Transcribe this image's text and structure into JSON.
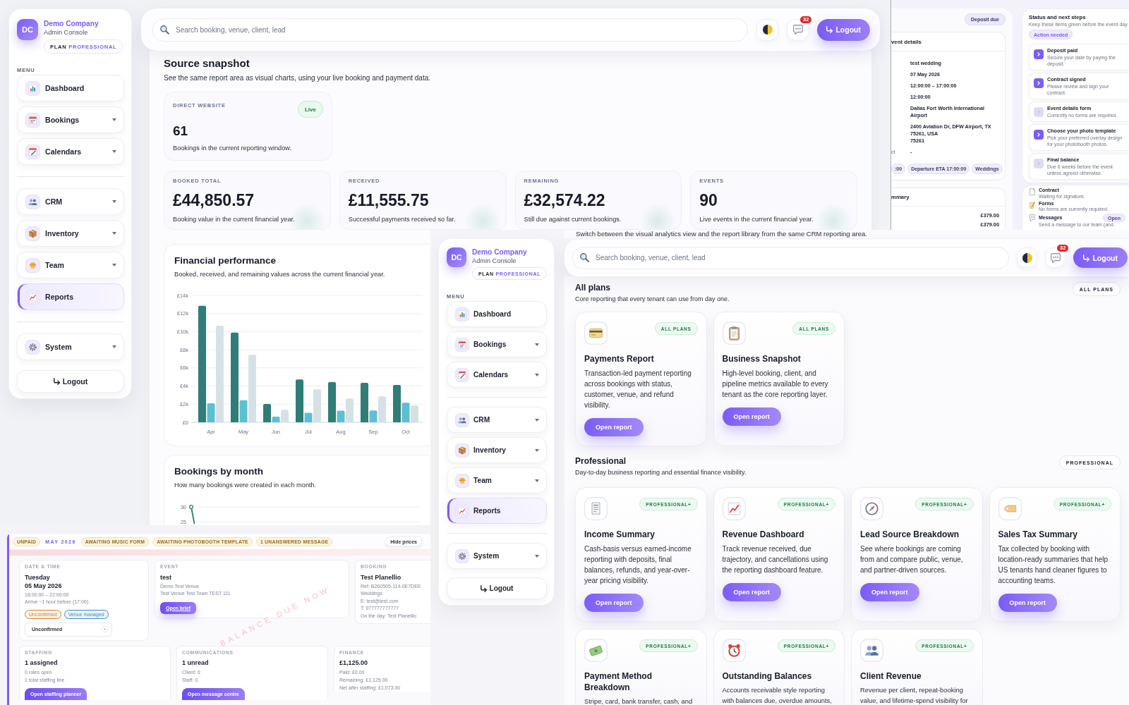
{
  "analytics_screen": {
    "sidebar": {
      "logo": "DC",
      "company": "Demo Company",
      "subtitle": "Admin Console",
      "plan_label": "PLAN",
      "plan_name": "PROFESSIONAL",
      "menu_label": "MENU",
      "groups": [
        [
          {
            "label": "Dashboard",
            "expandable": false,
            "selected": false
          },
          {
            "label": "Bookings",
            "expandable": true,
            "selected": false
          },
          {
            "label": "Calendars",
            "expandable": true,
            "selected": false
          }
        ],
        [
          {
            "label": "CRM",
            "expandable": true,
            "selected": false
          },
          {
            "label": "Inventory",
            "expandable": true,
            "selected": false
          },
          {
            "label": "Team",
            "expandable": true,
            "selected": false
          },
          {
            "label": "Reports",
            "expandable": false,
            "selected": true
          }
        ],
        [
          {
            "label": "System",
            "expandable": true,
            "selected": false
          }
        ]
      ],
      "logout": "Logout"
    },
    "topbar": {
      "search_placeholder": "Search booking, venue, client, lead",
      "notification_count": "32",
      "logout": "Logout"
    },
    "snapshot": {
      "title": "Source snapshot",
      "subtitle": "See the same report area as visual charts, using your live booking and payment data.",
      "source": {
        "label": "DIRECT WEBSITE",
        "status": "Live",
        "value": "61",
        "note": "Bookings in the current reporting window."
      }
    },
    "stats": [
      {
        "label": "BOOKED TOTAL",
        "value": "£44,850.57",
        "note": "Booking value in the current financial year."
      },
      {
        "label": "RECEIVED",
        "value": "£11,555.75",
        "note": "Successful payments received so far."
      },
      {
        "label": "REMAINING",
        "value": "£32,574.22",
        "note": "Still due against current bookings."
      },
      {
        "label": "EVENTS",
        "value": "90",
        "note": "Live events in the current financial year."
      }
    ],
    "financial_performance": {
      "title": "Financial performance",
      "subtitle": "Booked, received, and remaining values across the current financial year.",
      "chart_data": {
        "type": "bar",
        "categories": [
          "Apr",
          "May",
          "Jun",
          "Jul",
          "Aug",
          "Sep",
          "Oct"
        ],
        "series": [
          {
            "color": "#2f7d76",
            "values": [
              12850,
              9900,
              2030,
              4720,
              4430,
              4360,
              4130
            ]
          },
          {
            "color": "#5cc0d2",
            "values": [
              2100,
              2430,
              620,
              1050,
              1280,
              1310,
              2160
            ]
          },
          {
            "color": "#d6e1e5",
            "values": [
              10660,
              7440,
              1380,
              3640,
              2620,
              2850,
              1840
            ]
          }
        ],
        "ylim": [
          0,
          14000
        ],
        "yticks": [
          {
            "value": 0,
            "label": "£0"
          },
          {
            "value": 2000,
            "label": "£2k"
          },
          {
            "value": 4000,
            "label": "£4k"
          },
          {
            "value": 6000,
            "label": "£6k"
          },
          {
            "value": 8000,
            "label": "£8k"
          },
          {
            "value": 10000,
            "label": "£10k"
          },
          {
            "value": 12000,
            "label": "£12k"
          },
          {
            "value": 14000,
            "label": "£14k"
          }
        ],
        "grid": true
      }
    },
    "bookings_by_month": {
      "title": "Bookings by month",
      "subtitle": "How many bookings were created in each month.",
      "y_axis_labels": [
        "30",
        "25"
      ]
    }
  },
  "portal_screen": {
    "status_badge": "Deposit due",
    "details": {
      "title": "vent details",
      "rows": [
        {
          "value": "test wedding"
        },
        {
          "value": "07 May 2026"
        },
        {
          "value": "12:00:00 – 17:00:00"
        },
        {
          "value": "12:00:00"
        },
        {
          "value": "Dallas Fort Worth International Airport"
        },
        {
          "value": "2400 Aviation Dr, DFW Airport, TX 75261, USA\n75261"
        },
        {
          "label": "ct",
          "value": "-"
        }
      ],
      "tags": [
        ":00",
        "Departure ETA 17:00:00",
        "Weddings"
      ]
    },
    "summary": {
      "title": "mmary",
      "amounts": [
        "£379.00",
        "£379.00"
      ]
    },
    "steps_panel": {
      "title": "Status and next steps",
      "subtitle": "Keep these items green before the event day.",
      "badge": "Action needed",
      "steps": [
        {
          "title": "Deposit paid",
          "text": "Secure your date by paying the deposit.",
          "action_needed": true
        },
        {
          "title": "Contract signed",
          "text": "Please review and sign your contract.",
          "action_needed": true
        },
        {
          "title": "Event details form",
          "text": "Currently no forms are required.",
          "action_needed": false
        },
        {
          "title": "Choose your photo template",
          "text": "Pick your preferred overlay design for your photobooth photos.",
          "action_needed": true
        },
        {
          "title": "Final balance",
          "text": "Due 6 weeks before the event unless agreed otherwise.",
          "action_needed": false
        }
      ]
    },
    "documents": [
      {
        "title": "Contract",
        "text": "Waiting for signature."
      },
      {
        "title": "Forms",
        "text": "No forms are currently required."
      },
      {
        "title": "Messages",
        "text": "Send a message to our team (and",
        "button": "Open"
      }
    ]
  },
  "booking_screen": {
    "chips": [
      {
        "label": "UNPAID",
        "kind": "status"
      },
      {
        "label": "MAY 2026",
        "kind": "month"
      },
      {
        "label": "AWAITING MUSIC FORM",
        "kind": "status"
      },
      {
        "label": "AWAITING PHOTOBOOTH TEMPLATE",
        "kind": "status"
      },
      {
        "label": "1 UNANSWERED MESSAGE",
        "kind": "status"
      }
    ],
    "hide_prices": "Hide prices",
    "rows": [
      [
        {
          "label": "DATE & TIME",
          "title": "Tuesday\n05 May 2026",
          "lines": [
            "18:00:00 – 22:00:00",
            "Arrive ~1 hour before (17:00)"
          ],
          "tags": [
            {
              "label": "Unconfirmed",
              "color": "#d9822b"
            },
            {
              "label": "Venue managed",
              "color": "#3a8fc4"
            }
          ],
          "select": "Unconfirmed"
        },
        {
          "label": "EVENT",
          "title": "test",
          "lines": [
            "Demo Test Venue",
            "Test Venue Test Town TEST 111"
          ],
          "button": "Open brief"
        },
        {
          "label": "BOOKING",
          "title": "Test Planellio",
          "lines": [
            "Ref: B260505-114-0E7DEE",
            "Weddings",
            "E: test@test.com",
            "T: 077777777777",
            "On the day: Test Planellio"
          ]
        }
      ],
      [
        {
          "label": "STAFFING",
          "title": "1 assigned",
          "lines": [
            "0 roles open",
            "1 total staffing line"
          ],
          "button": "Open staffing planner"
        },
        {
          "label": "COMMUNICATIONS",
          "title": "1 unread",
          "lines": [
            "Client: 0",
            "Staff: 0"
          ],
          "button": "Open message centre"
        },
        {
          "label": "FINANCE",
          "title": "£1,125.00",
          "lines": [
            "Paid: £0.00",
            "Remaining: £1,125.00",
            "Net after staffing: £1,073.00"
          ]
        }
      ]
    ],
    "stamp": "BALANCE DUE NOW"
  },
  "reports_screen": {
    "intro": "Switch between the visual analytics view and the report library from the same CRM reporting area.",
    "sidebar": {
      "logo": "DC",
      "company": "Demo Company",
      "subtitle": "Admin Console",
      "plan_label": "PLAN",
      "plan_name": "PROFESSIONAL",
      "menu_label": "MENU",
      "groups": [
        [
          {
            "label": "Dashboard",
            "expandable": false,
            "selected": false
          },
          {
            "label": "Bookings",
            "expandable": true,
            "selected": false
          },
          {
            "label": "Calendars",
            "expandable": true,
            "selected": false
          }
        ],
        [
          {
            "label": "CRM",
            "expandable": true,
            "selected": false
          },
          {
            "label": "Inventory",
            "expandable": true,
            "selected": false
          },
          {
            "label": "Team",
            "expandable": true,
            "selected": false
          },
          {
            "label": "Reports",
            "expandable": false,
            "selected": true
          }
        ],
        [
          {
            "label": "System",
            "expandable": true,
            "selected": false
          }
        ]
      ],
      "logout": "Logout"
    },
    "topbar": {
      "search_placeholder": "Search booking, venue, client, lead",
      "notification_count": "32",
      "logout": "Logout"
    },
    "sections": [
      {
        "title": "All plans",
        "subtitle": "Core reporting that every tenant can use from day one.",
        "badge": "ALL PLANS",
        "reports": [
          {
            "title": "Payments Report",
            "tier": "ALL PLANS",
            "description": "Transaction-led payment reporting across bookings with status, customer, venue, and refund visibility.",
            "button": "Open report"
          },
          {
            "title": "Business Snapshot",
            "tier": "ALL PLANS",
            "description": "High-level booking, client, and pipeline metrics available to every tenant as the core reporting layer.",
            "button": "Open report"
          }
        ]
      },
      {
        "title": "Professional",
        "subtitle": "Day-to-day business reporting and essential finance visibility.",
        "badge": "PROFESSIONAL",
        "reports": [
          {
            "title": "Income Summary",
            "tier": "PROFESSIONAL+",
            "description": "Cash-basis versus earned-income reporting with deposits, final balances, refunds, and year-over-year pricing visibility.",
            "button": "Open report"
          },
          {
            "title": "Revenue Dashboard",
            "tier": "PROFESSIONAL+",
            "description": "Track revenue received, due trajectory, and cancellations using the reporting dashboard feature.",
            "button": "Open report"
          },
          {
            "title": "Lead Source Breakdown",
            "tier": "PROFESSIONAL+",
            "description": "See where bookings are coming from and compare public, venue, and partner-driven sources.",
            "button": "Open report"
          },
          {
            "title": "Sales Tax Summary",
            "tier": "PROFESSIONAL+",
            "description": "Tax collected by booking with location-ready summaries that help US tenants hand cleaner figures to accounting teams.",
            "button": "Open report"
          },
          {
            "title": "Payment Method Breakdown",
            "tier": "PROFESSIONAL+",
            "description": "Stripe, card, bank transfer, cash, and"
          },
          {
            "title": "Outstanding Balances",
            "tier": "PROFESSIONAL+",
            "description": "Accounts receivable style reporting with balances due, overdue amounts,"
          },
          {
            "title": "Client Revenue",
            "tier": "PROFESSIONAL+",
            "description": "Revenue per client, repeat-booking value, and lifetime-spend visibility for"
          }
        ]
      }
    ]
  }
}
